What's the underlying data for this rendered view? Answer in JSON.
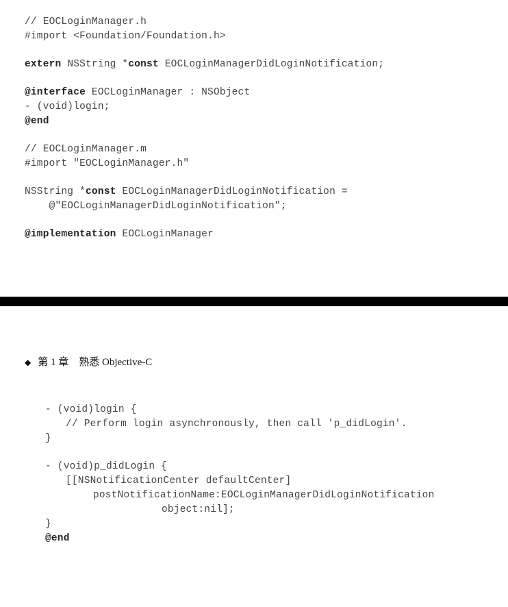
{
  "top": {
    "l1": "// EOCLoginManager.h",
    "l2": "#import <Foundation/Foundation.h>",
    "l3a": "extern",
    "l3b": " NSString *",
    "l3c": "const",
    "l3d": " EOCLoginManagerDidLoginNotification;",
    "l4a": "@interface",
    "l4b": " EOCLoginManager : NSObject",
    "l5": "- (void)login;",
    "l6": "@end",
    "l7": "// EOCLoginManager.m",
    "l8": "#import \"EOCLoginManager.h\"",
    "l9a": "NSString *",
    "l9b": "const",
    "l9c": " EOCLoginManagerDidLoginNotification =",
    "l10": "    @\"EOCLoginManagerDidLoginNotification\";",
    "l11a": "@implementation",
    "l11b": " EOCLoginManager"
  },
  "bottom": {
    "chapter": "第 1 章　熟悉 Objective-C",
    "b1": "- (void)login {",
    "b2": "// Perform login asynchronously, then call 'p_didLogin'.",
    "b3": "}",
    "b4": "- (void)p_didLogin {",
    "b5": "[[NSNotificationCenter defaultCenter]",
    "b6": "postNotificationName:EOCLoginManagerDidLoginNotification",
    "b7": "object:nil];",
    "b8": "}",
    "b9": "@end"
  }
}
